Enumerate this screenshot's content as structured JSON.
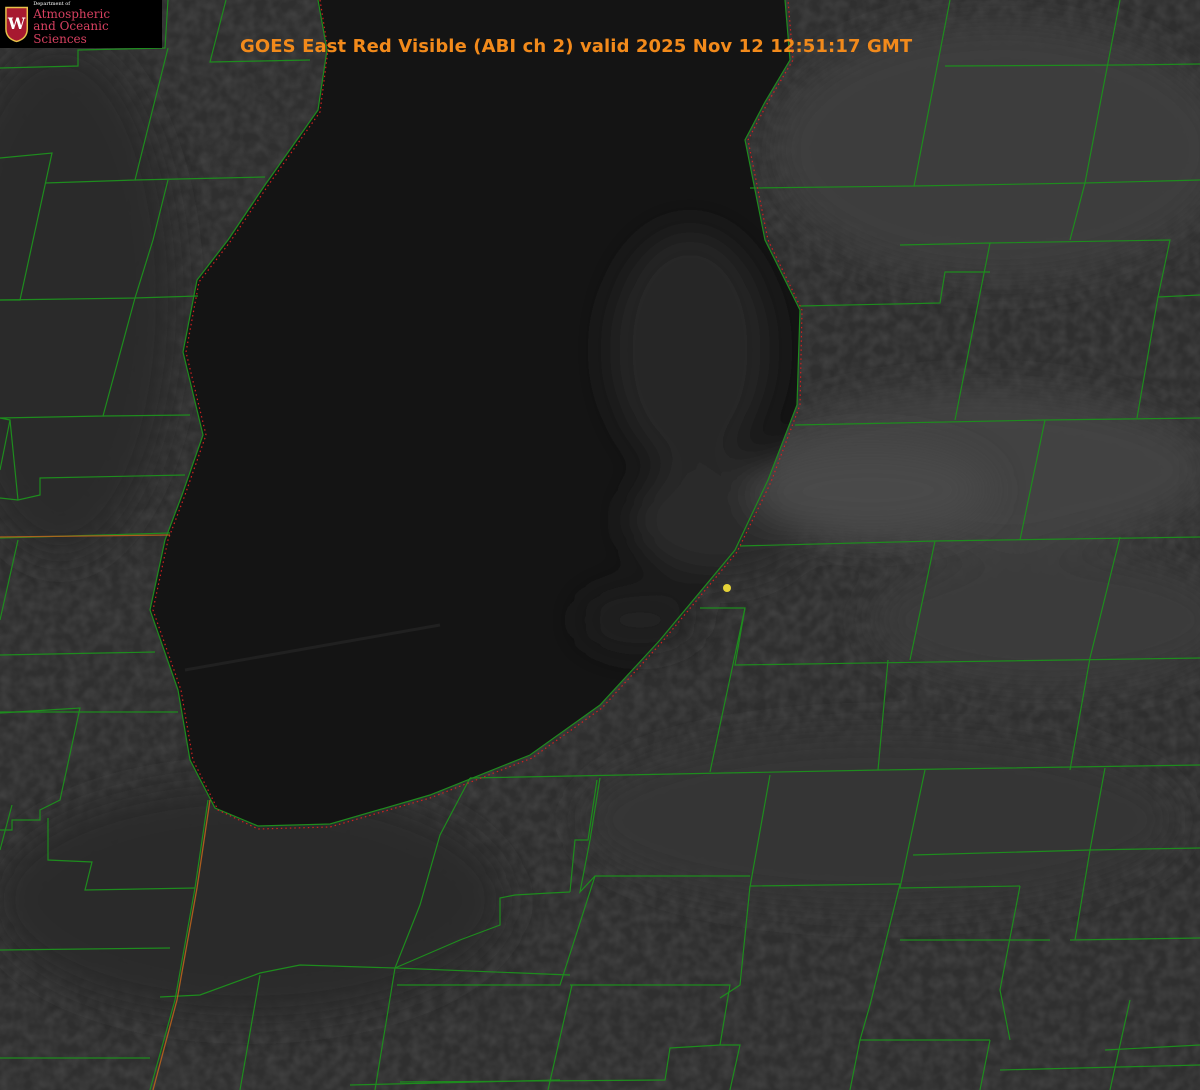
{
  "title": "GOES East Red Visible (ABI ch 2) valid 2025 Nov 12 12:51:17 GMT",
  "logo": {
    "dept": "Department of",
    "line1": "Atmospheric",
    "line2": "and Oceanic Sciences",
    "seal_text": "W"
  },
  "colors": {
    "title": "#f28a1b",
    "county_lines": "#1e8c1e",
    "coastline": "#d02020",
    "state_line": "#b8621e",
    "marker": "#e5d338",
    "lake": "#141414",
    "land": "#303030"
  },
  "layers": {
    "background": "visible satellite imagery (grayscale)",
    "county_boundaries": "county-lines",
    "shoreline": "coastline-dotted",
    "state_boundary": "state-line",
    "point_marker": "location-dot"
  }
}
